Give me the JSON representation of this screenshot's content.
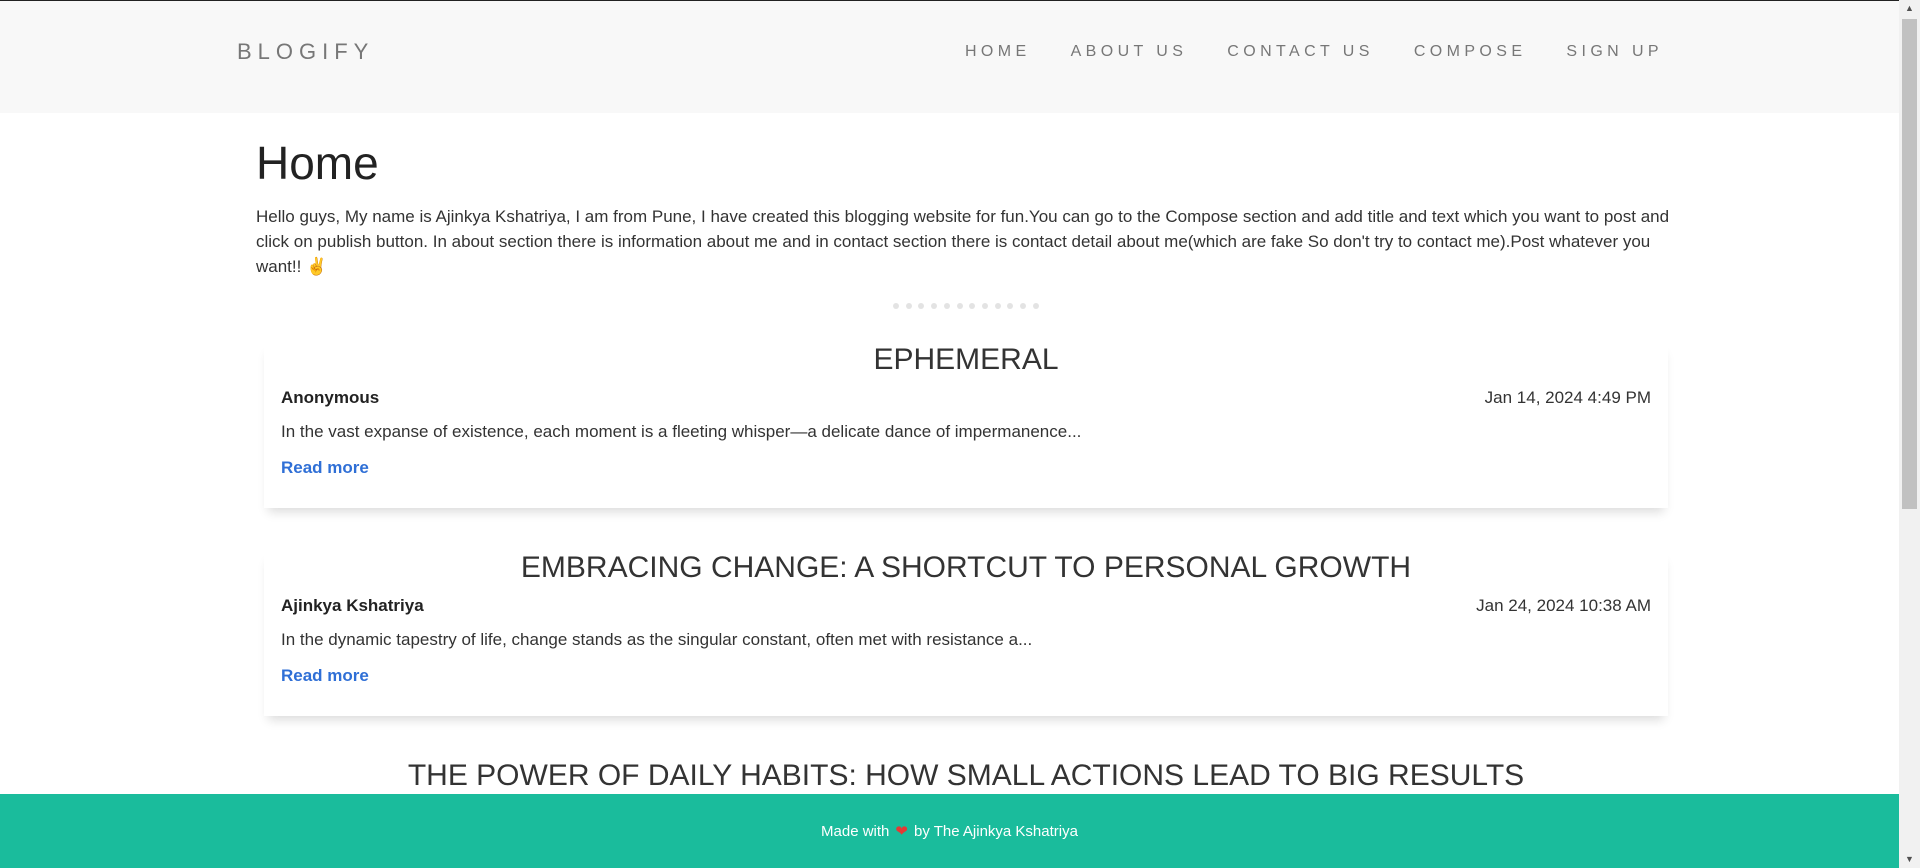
{
  "nav": {
    "brand": "BLOGIFY",
    "items": [
      "HOME",
      "ABOUT US",
      "CONTACT US",
      "COMPOSE",
      "SIGN UP"
    ]
  },
  "main": {
    "title": "Home",
    "intro": "Hello guys, My name is Ajinkya Kshatriya, I am from Pune, I have created this blogging website for fun.You can go to the Compose section and add title and text which you want to post and click on publish button. In about section there is information about me and in contact section there is contact detail about me(which are fake So don't try to contact me).Post whatever you want!! ✌️"
  },
  "posts": [
    {
      "title": "EPHEMERAL",
      "author": "Anonymous",
      "date": "Jan 14, 2024 4:49 PM",
      "excerpt": "In the vast expanse of existence, each moment is a fleeting whisper—a delicate dance of impermanence...",
      "read_more": "Read more"
    },
    {
      "title": "EMBRACING CHANGE: A SHORTCUT TO PERSONAL GROWTH",
      "author": "Ajinkya Kshatriya",
      "date": "Jan 24, 2024 10:38 AM",
      "excerpt": "In the dynamic tapestry of life, change stands as the singular constant, often met with resistance a...",
      "read_more": "Read more"
    },
    {
      "title": "THE POWER OF DAILY HABITS: HOW SMALL ACTIONS LEAD TO BIG RESULTS"
    }
  ],
  "footer": {
    "text_before": "Made with",
    "heart": "❤",
    "text_after": "by The Ajinkya Kshatriya"
  },
  "colors": {
    "footer_bg": "#1abc9c",
    "navbar_bg": "#f8f8f8",
    "link": "#2f6fd6"
  }
}
